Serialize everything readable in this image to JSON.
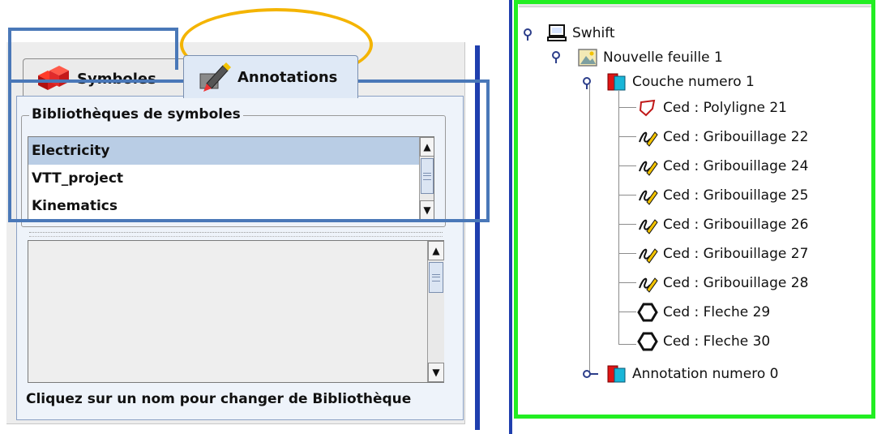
{
  "left_panel": {
    "tabs": [
      {
        "label": "Symboles",
        "icon": "red-cubes-icon"
      },
      {
        "label": "Annotations",
        "icon": "pen-annotation-icon"
      }
    ],
    "library_group_title": "Bibliothèques de symboles",
    "libraries": [
      {
        "label": "Electricity",
        "selected": true
      },
      {
        "label": "VTT_project",
        "selected": false
      },
      {
        "label": "Kinematics",
        "selected": false
      }
    ],
    "hint": "Cliquez sur un nom pour changer de Bibliothèque"
  },
  "tree": {
    "root": {
      "label": "Swhift",
      "icon": "computer-icon"
    },
    "sheet": {
      "label": "Nouvelle feuille 1",
      "icon": "landscape-image-icon"
    },
    "layer": {
      "label": "Couche numero 1",
      "icon": "layer-icon"
    },
    "items": [
      {
        "label": "Ced : Polyligne 21",
        "icon": "polyline-icon"
      },
      {
        "label": "Ced : Gribouillage 22",
        "icon": "scribble-icon"
      },
      {
        "label": "Ced : Gribouillage 24",
        "icon": "scribble-icon"
      },
      {
        "label": "Ced : Gribouillage 25",
        "icon": "scribble-icon"
      },
      {
        "label": "Ced : Gribouillage 26",
        "icon": "scribble-icon"
      },
      {
        "label": "Ced : Gribouillage 27",
        "icon": "scribble-icon"
      },
      {
        "label": "Ced : Gribouillage 28",
        "icon": "scribble-icon"
      },
      {
        "label": "Ced : Fleche 29",
        "icon": "hexagon-icon"
      },
      {
        "label": "Ced : Fleche 30",
        "icon": "hexagon-icon"
      }
    ],
    "annotation_layer": {
      "label": "Annotation numero 0",
      "icon": "layer-icon"
    }
  },
  "colors": {
    "highlight_blue": "#4a78b8",
    "highlight_yellow": "#f4b400",
    "highlight_green": "#22ee22",
    "selection": "#b9cde5"
  }
}
